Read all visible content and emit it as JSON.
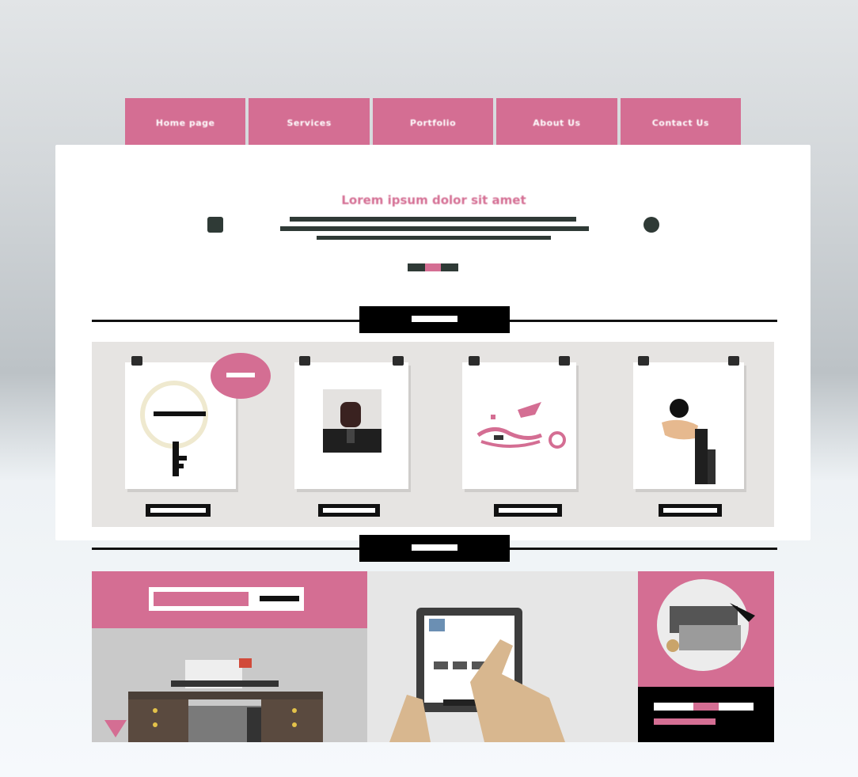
{
  "tabs": [
    {
      "label": "Home page"
    },
    {
      "label": "Services"
    },
    {
      "label": "Portfolio"
    },
    {
      "label": "About Us"
    },
    {
      "label": "Contact Us"
    }
  ],
  "hero": {
    "title": "Lorem ipsum dolor sit amet"
  },
  "colors": {
    "accent": "#d46e93",
    "dark": "#2f3a36",
    "black": "#000000",
    "panel": "#ffffff",
    "gallery_bg": "#e6e4e2"
  },
  "gallery": {
    "cards": [
      {
        "icon": "key-magnifier-icon"
      },
      {
        "icon": "businessman-portrait-icon"
      },
      {
        "icon": "bird-lantern-icon"
      },
      {
        "icon": "stopwatch-hand-icon"
      }
    ]
  },
  "bottom": {
    "tiles": [
      {
        "icon": "office-desk-icon"
      },
      {
        "icon": "tablet-hands-icon"
      },
      {
        "icon": "printer-icon"
      }
    ]
  }
}
